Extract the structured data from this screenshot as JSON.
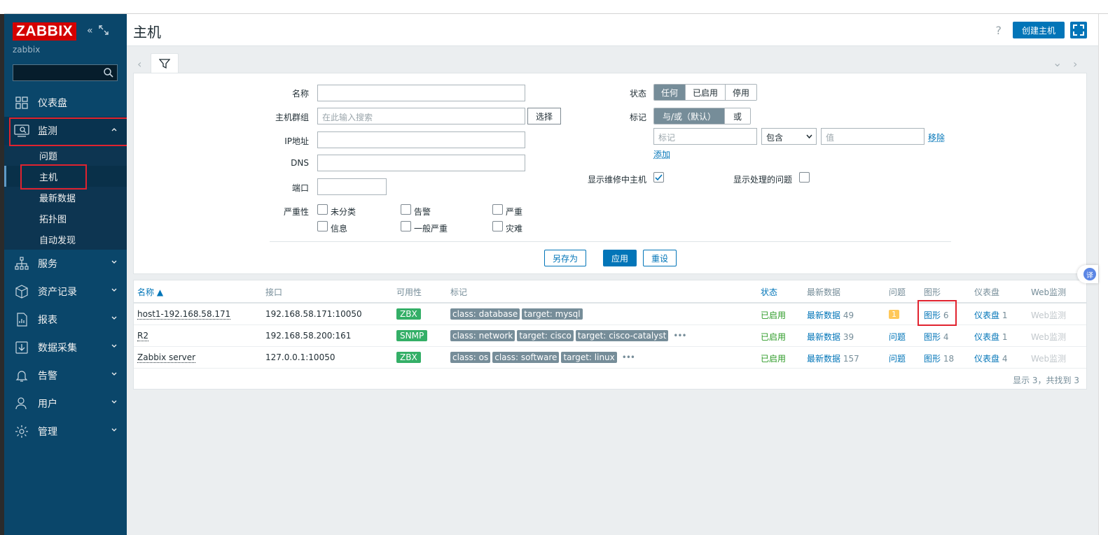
{
  "sidebar": {
    "logo": "ZABBIX",
    "server_name": "zabbix",
    "nav": [
      {
        "label": "仪表盘",
        "icon": "dashboard-icon"
      },
      {
        "label": "监测",
        "icon": "monitoring-icon"
      },
      {
        "label": "服务",
        "icon": "services-icon"
      },
      {
        "label": "资产记录",
        "icon": "inventory-icon"
      },
      {
        "label": "报表",
        "icon": "reports-icon"
      },
      {
        "label": "数据采集",
        "icon": "data-collection-icon"
      },
      {
        "label": "告警",
        "icon": "alerts-icon"
      },
      {
        "label": "用户",
        "icon": "users-icon"
      },
      {
        "label": "管理",
        "icon": "administration-icon"
      }
    ],
    "monitoring_sub": [
      "问题",
      "主机",
      "最新数据",
      "拓扑图",
      "自动发现"
    ]
  },
  "header": {
    "title": "主机",
    "help": "?",
    "create_button": "创建主机"
  },
  "filter": {
    "name_label": "名称",
    "hostgroup_label": "主机群组",
    "hostgroup_placeholder": "在此输入搜索",
    "select_button": "选择",
    "ip_label": "IP地址",
    "dns_label": "DNS",
    "port_label": "端口",
    "severity_label": "严重性",
    "severities": [
      "未分类",
      "告警",
      "严重",
      "信息",
      "一般严重",
      "灾难"
    ],
    "status_label": "状态",
    "status_options": [
      "任何",
      "已启用",
      "停用"
    ],
    "tags_label": "标记",
    "tag_mode_options": [
      "与/或（默认）",
      "或"
    ],
    "tag_placeholder": "标记",
    "tag_operator": "包含",
    "tag_value_placeholder": "值",
    "remove_link": "移除",
    "add_link": "添加",
    "maintenance_label": "显示维修中主机",
    "suppressed_label": "显示处理的问题",
    "save_as": "另存为",
    "apply": "应用",
    "reset": "重设"
  },
  "table": {
    "headers": [
      "名称 ▲",
      "接口",
      "可用性",
      "标记",
      "状态",
      "最新数据",
      "问题",
      "图形",
      "仪表盘",
      "Web监测"
    ],
    "rows": [
      {
        "name": "host1-192.168.58.171",
        "interface": "192.168.58.171:10050",
        "availability": "ZBX",
        "tags": [
          "class: database",
          "target: mysql"
        ],
        "more": "",
        "status": "已启用",
        "latest": "最新数据",
        "latest_count": "49",
        "problems": "1",
        "graphs": "图形",
        "graphs_count": "6",
        "dashboards": "仪表盘",
        "dashboards_count": "1",
        "web": "Web监测"
      },
      {
        "name": "R2",
        "interface": "192.168.58.200:161",
        "availability": "SNMP",
        "tags": [
          "class: network",
          "target: cisco",
          "target: cisco-catalyst"
        ],
        "more": "•••",
        "status": "已启用",
        "latest": "最新数据",
        "latest_count": "39",
        "problems": "问题",
        "graphs": "图形",
        "graphs_count": "4",
        "dashboards": "仪表盘",
        "dashboards_count": "1",
        "web": "Web监测"
      },
      {
        "name": "Zabbix server",
        "interface": "127.0.0.1:10050",
        "availability": "ZBX",
        "tags": [
          "class: os",
          "class: software",
          "target: linux"
        ],
        "more": "•••",
        "status": "已启用",
        "latest": "最新数据",
        "latest_count": "157",
        "problems": "问题",
        "graphs": "图形",
        "graphs_count": "18",
        "dashboards": "仪表盘",
        "dashboards_count": "4",
        "web": "Web监测"
      }
    ],
    "footer": "显示 3，共找到 3"
  },
  "translate_badge": "译",
  "colors": {
    "sidebar": "#0a466a",
    "accent": "#0275b8",
    "logo": "#d40000",
    "enabled": "#2d9b27",
    "availability": "#34af67",
    "tag": "#768d99"
  }
}
